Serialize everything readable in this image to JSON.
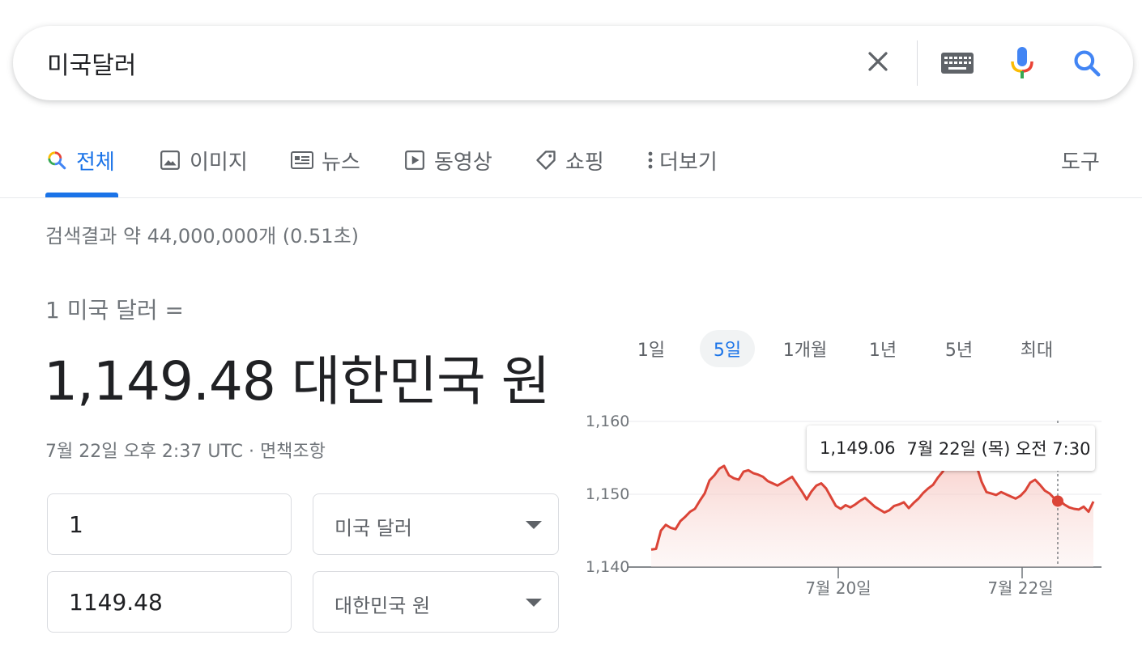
{
  "search": {
    "query": "미국달러"
  },
  "tabs": [
    {
      "label": "전체",
      "icon": "search-icon"
    },
    {
      "label": "이미지",
      "icon": "image-icon"
    },
    {
      "label": "뉴스",
      "icon": "news-icon"
    },
    {
      "label": "동영상",
      "icon": "video-icon"
    },
    {
      "label": "쇼핑",
      "icon": "tag-icon"
    },
    {
      "label": "더보기",
      "icon": "more-vert-icon"
    }
  ],
  "tools_label": "도구",
  "result_stats": "검색결과 약 44,000,000개 (0.51초)",
  "converter": {
    "label": "1 미국 달러 =",
    "value": "1,149.48 대한민국 원",
    "timestamp": "7월 22일 오후 2:37 UTC",
    "separator": " · ",
    "disclaimer": "면책조항",
    "from_amount": "1",
    "from_currency": "미국 달러",
    "to_amount": "1149.48",
    "to_currency": "대한민국 원"
  },
  "range_tabs": [
    "1일",
    "5일",
    "1개월",
    "1년",
    "5년",
    "최대"
  ],
  "active_range": "5일",
  "tooltip": {
    "value": "1,149.06",
    "time": "7월 22일 (목) 오전 7:30"
  },
  "colors": {
    "accent": "#1a73e8",
    "line": "#db4437",
    "fill": "#f8d7d3"
  },
  "chart_data": {
    "type": "area",
    "title": "",
    "ylim": [
      1140,
      1160
    ],
    "yticks": [
      "1,160",
      "1,150",
      "1,140"
    ],
    "xtick_labels": [
      "7월 20일",
      "7월 22일"
    ],
    "grid": true,
    "series": [
      {
        "values": [
          1142.4,
          1142.5,
          1145.0,
          1145.8,
          1145.4,
          1145.2,
          1146.3,
          1146.9,
          1147.6,
          1148.0,
          1149.1,
          1150.1,
          1151.9,
          1152.6,
          1153.5,
          1153.9,
          1152.6,
          1152.2,
          1152.0,
          1153.1,
          1153.3,
          1152.9,
          1152.7,
          1152.4,
          1151.8,
          1151.5,
          1151.2,
          1151.6,
          1152.0,
          1152.4,
          1151.4,
          1150.4,
          1149.3,
          1150.4,
          1151.2,
          1151.5,
          1150.8,
          1149.6,
          1148.4,
          1148.0,
          1148.5,
          1148.2,
          1148.6,
          1149.1,
          1149.5,
          1148.9,
          1148.3,
          1147.9,
          1147.5,
          1147.8,
          1148.4,
          1148.6,
          1148.9,
          1148.1,
          1148.8,
          1149.4,
          1150.2,
          1150.8,
          1151.3,
          1152.3,
          1153.1,
          1154.5,
          1156.0,
          1157.2,
          1157.8,
          1157.0,
          1155.6,
          1153.8,
          1151.7,
          1150.3,
          1150.1,
          1149.9,
          1150.3,
          1150.0,
          1149.7,
          1149.4,
          1149.8,
          1150.5,
          1151.6,
          1152.0,
          1151.3,
          1150.5,
          1150.1,
          1149.4,
          1149.2,
          1148.6,
          1148.2,
          1148.0,
          1147.9,
          1148.3,
          1147.6,
          1149.0
        ]
      }
    ]
  }
}
